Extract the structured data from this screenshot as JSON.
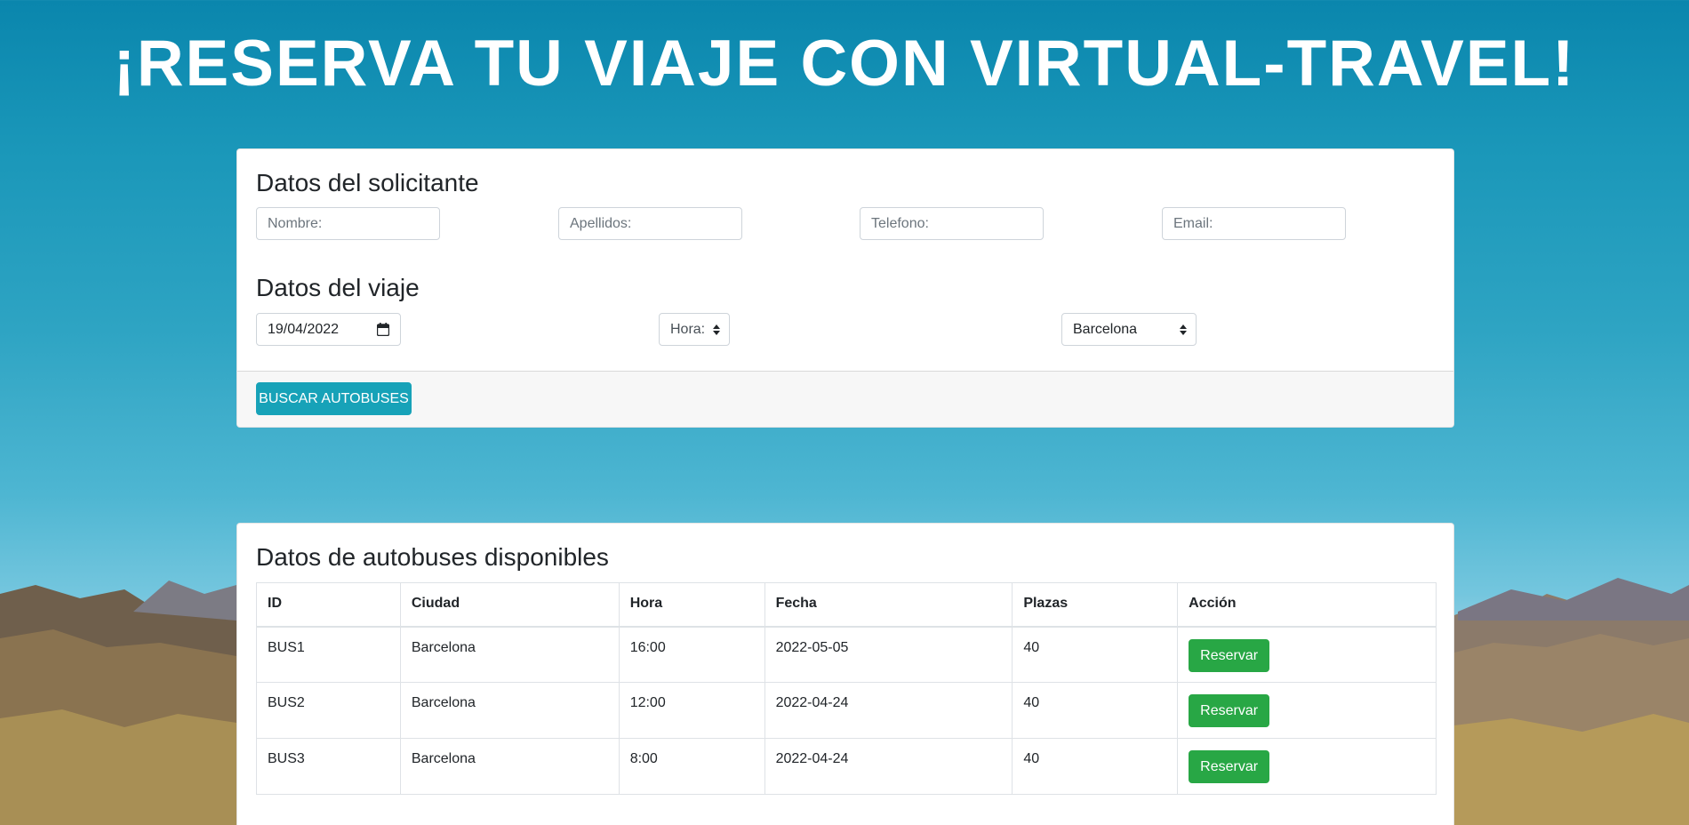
{
  "page_title": "¡RESERVA TU VIAJE CON VIRTUAL-TRAVEL!",
  "colors": {
    "primary_button": "#17a2b8",
    "success_button": "#28a745",
    "sky_top": "#0a86ad"
  },
  "solicitante": {
    "heading": "Datos del solicitante",
    "nombre_placeholder": "Nombre:",
    "apellidos_placeholder": "Apellidos:",
    "telefono_placeholder": "Telefono:",
    "email_placeholder": "Email:"
  },
  "viaje": {
    "heading": "Datos del viaje",
    "fecha_value": "19/04/2022",
    "hora_value": "Hora:",
    "destino_value": "Barcelona",
    "fecha_icon": "calendar-icon",
    "select_icon": "updown-icon"
  },
  "buscar_label": "BUSCAR AUTOBUSES",
  "autobuses": {
    "heading": "Datos de autobuses disponibles",
    "columns": [
      "ID",
      "Ciudad",
      "Hora",
      "Fecha",
      "Plazas",
      "Acción"
    ],
    "rows": [
      {
        "id": "BUS1",
        "ciudad": "Barcelona",
        "hora": "16:00",
        "fecha": "2022-05-05",
        "plazas": "40",
        "accion": "Reservar"
      },
      {
        "id": "BUS2",
        "ciudad": "Barcelona",
        "hora": "12:00",
        "fecha": "2022-04-24",
        "plazas": "40",
        "accion": "Reservar"
      },
      {
        "id": "BUS3",
        "ciudad": "Barcelona",
        "hora": "8:00",
        "fecha": "2022-04-24",
        "plazas": "40",
        "accion": "Reservar"
      }
    ]
  }
}
